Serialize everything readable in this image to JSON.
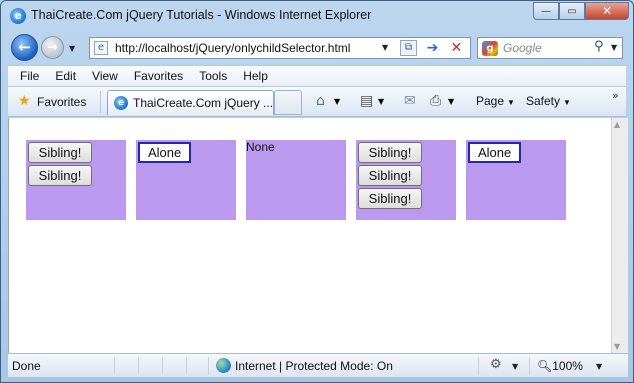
{
  "window": {
    "title": "ThaiCreate.Com jQuery Tutorials - Windows Internet Explorer",
    "controls": {
      "minimize": "—",
      "maximize": "▭",
      "close": "✕"
    }
  },
  "address_bar": {
    "url": "http://localhost/jQuery/onlychildSelector.html"
  },
  "search": {
    "placeholder": "Google",
    "logo_letter": "g"
  },
  "menu": {
    "items": [
      "File",
      "Edit",
      "View",
      "Favorites",
      "Tools",
      "Help"
    ]
  },
  "favorites_bar": {
    "favorites_label": "Favorites",
    "tab_label": "ThaiCreate.Com jQuery ...",
    "commands": {
      "page": "Page",
      "safety": "Safety"
    }
  },
  "content": {
    "boxes": [
      {
        "buttons": [
          "Sibling!",
          "Sibling!"
        ]
      },
      {
        "alone_button": "Alone"
      },
      {
        "text": "None"
      },
      {
        "buttons": [
          "Sibling!",
          "Sibling!",
          "Sibling!"
        ]
      },
      {
        "alone_button": "Alone"
      }
    ],
    "box_color": "#bb99ee",
    "focus_border_color": "#1e2ab5"
  },
  "status_bar": {
    "status": "Done",
    "zone": "Internet | Protected Mode: On",
    "zoom": "100%"
  },
  "icons": {
    "ie": "ie-logo-icon",
    "back": "back-arrow-icon",
    "forward": "forward-arrow-icon",
    "home": "home-icon",
    "feeds": "feeds-icon",
    "mail": "mail-icon",
    "print": "print-icon",
    "star": "favorites-star-icon"
  }
}
